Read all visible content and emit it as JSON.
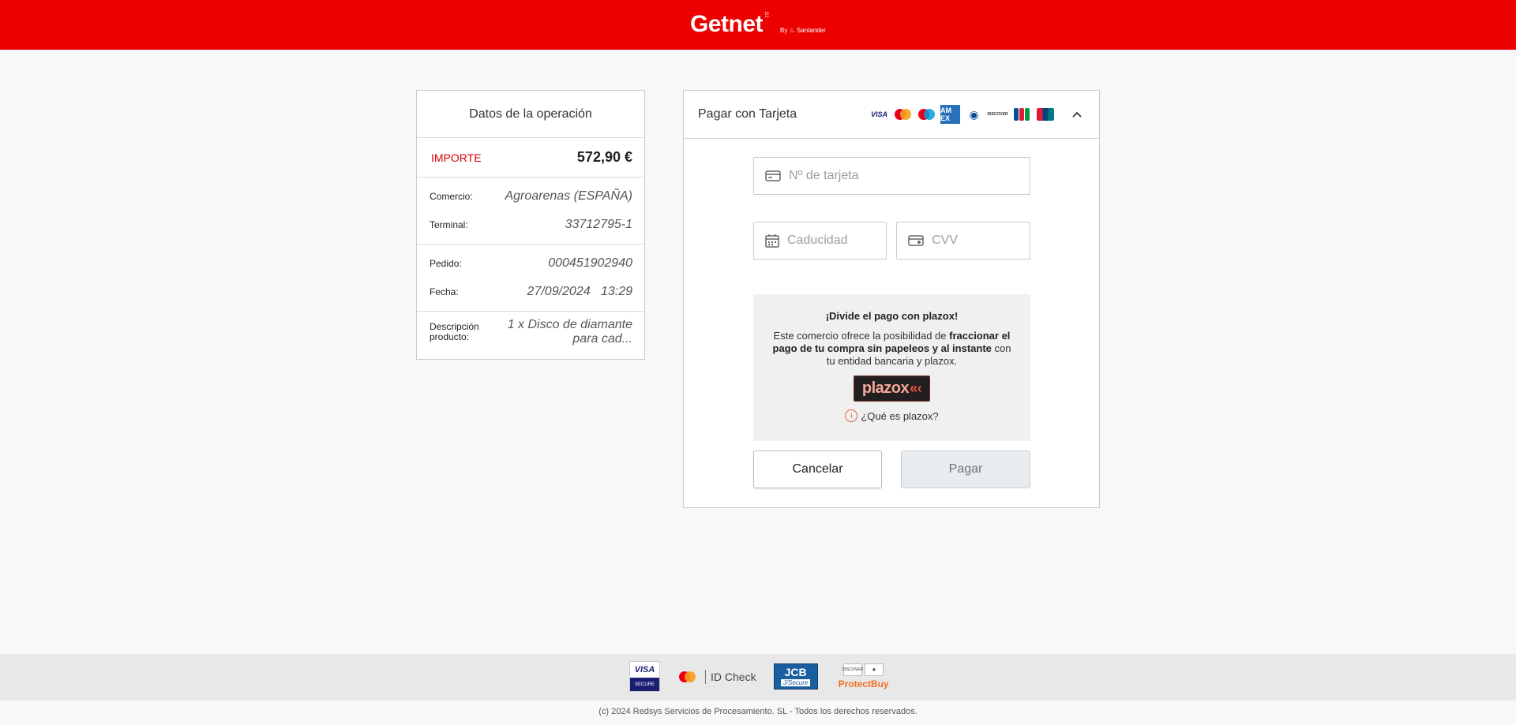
{
  "header": {
    "brand_name": "Getnet",
    "brand_dots": "⠿",
    "brand_byline": "By ♨ Santander",
    "colors": {
      "brand_red": "#ec0000"
    }
  },
  "operation": {
    "title": "Datos de la operación",
    "amount_label": "IMPORTE",
    "amount_value": "572,90 €",
    "rows": [
      {
        "label": "Comercio:",
        "value": "Agroarenas (ESPAÑA)"
      },
      {
        "label": "Terminal:",
        "value": "33712795-1"
      },
      {
        "label": "Pedido:",
        "value": "000451902940"
      },
      {
        "label": "Fecha:",
        "value": "27/09/2024   13:29"
      },
      {
        "label": "Descripción producto:",
        "value": "1 x Disco de diamante para cad..."
      }
    ]
  },
  "payment": {
    "title": "Pagar con Tarjeta",
    "brand_labels": {
      "visa": "VISA",
      "amex": "AM EX",
      "diners": "◉",
      "discover": "DISCOVER"
    },
    "card_number_placeholder": "Nº de tarjeta",
    "expiry_placeholder": "Caducidad",
    "cvv_placeholder": "CVV",
    "icons": [
      "card-icon",
      "calendar-icon",
      "cvv-card-icon",
      "chevron-up-icon",
      "info-icon"
    ],
    "plazox": {
      "title": "¡Divide el pago con plazox!",
      "text_1": "Este comercio ofrece la posibilidad de ",
      "text_bold": "fraccionar el pago de tu compra sin papeleos y al instante",
      "text_2": " con tu entidad bancaria y plazox.",
      "logo_text": "plazox",
      "logo_arrows": "«‹",
      "info_glyph": "i",
      "info_link": "¿Qué es plazox?"
    },
    "cancel_label": "Cancelar",
    "pay_label": "Pagar"
  },
  "footer": {
    "visa_secure_top": "VISA",
    "visa_secure_bottom": "SECURE",
    "id_check": "ID Check",
    "jcb_top": "JCB",
    "jcb_bottom": "J/Secure",
    "protectbuy_card_1": "DISCOVER",
    "protectbuy_card_2": "◉",
    "protectbuy": "ProtectBuy",
    "copyright": "(c) 2024 Redsys Servicios de Procesamiento. SL - Todos los derechos reservados."
  }
}
